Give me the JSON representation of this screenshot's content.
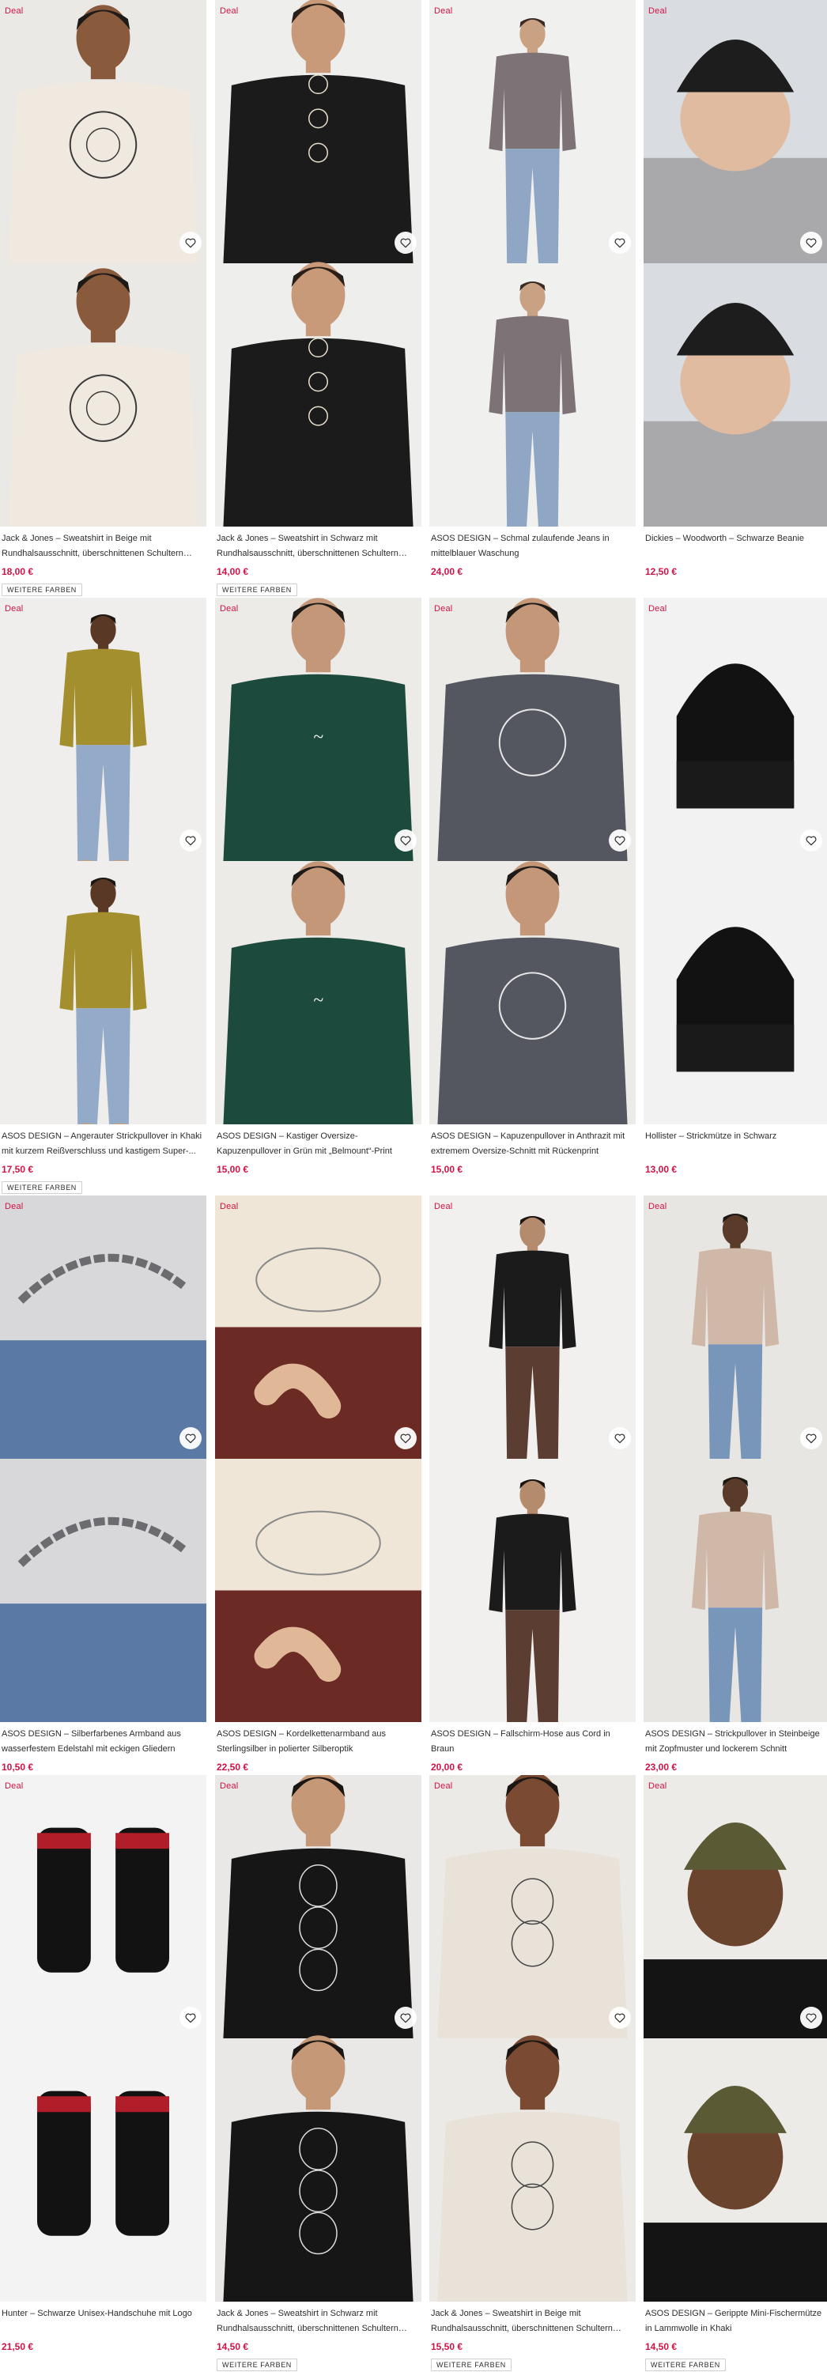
{
  "deal_label": "Deal",
  "more_colors_label": "WEITERE FARBEN",
  "colors": {
    "accent": "#d01345",
    "text": "#2d2d2d"
  },
  "products": [
    {
      "title": "Jack & Jones – Sweatshirt in Beige mit Rundhalsausschnitt, überschnittenen Schultern und...",
      "price": "18,00 €",
      "deal": true,
      "more_colors": true,
      "kind": "sweat-beige"
    },
    {
      "title": "Jack & Jones – Sweatshirt in Schwarz mit Rundhalsausschnitt, überschnittenen Schultern und...",
      "price": "14,00 €",
      "deal": true,
      "more_colors": true,
      "kind": "sweat-black"
    },
    {
      "title": "ASOS DESIGN – Schmal zulaufende Jeans in mittelblauer Waschung",
      "price": "24,00 €",
      "deal": true,
      "more_colors": false,
      "kind": "jeans"
    },
    {
      "title": "Dickies – Woodworth – Schwarze Beanie",
      "price": "12,50 €",
      "deal": true,
      "more_colors": false,
      "kind": "beanie-black"
    },
    {
      "title": "ASOS DESIGN – Angerauter Strickpullover in Khaki mit kurzem Reißverschluss und kastigem Super-...",
      "price": "17,50 €",
      "deal": true,
      "more_colors": true,
      "kind": "knit-khaki"
    },
    {
      "title": "ASOS DESIGN – Kastiger Oversize-Kapuzenpullover in Grün mit „Belmount“-Print",
      "price": "15,00 €",
      "deal": true,
      "more_colors": false,
      "kind": "hoodie-green"
    },
    {
      "title": "ASOS DESIGN – Kapuzenpullover in Anthrazit mit extremem Oversize-Schnitt mit Rückenprint",
      "price": "15,00 €",
      "deal": true,
      "more_colors": false,
      "kind": "hoodie-grey"
    },
    {
      "title": "Hollister – Strickmütze in Schwarz",
      "price": "13,00 €",
      "deal": true,
      "more_colors": false,
      "kind": "beanie-hollister"
    },
    {
      "title": "ASOS DESIGN – Silberfarbenes Armband aus wasserfestem Edelstahl mit eckigen Gliedern",
      "price": "10,50 €",
      "deal": true,
      "more_colors": false,
      "kind": "bracelet-chain"
    },
    {
      "title": "ASOS DESIGN – Kordelkettenarmband aus Sterlingsilber in polierter Silberoptik",
      "price": "22,50 €",
      "deal": true,
      "more_colors": false,
      "kind": "bracelet-cord"
    },
    {
      "title": "ASOS DESIGN – Fallschirm-Hose aus Cord in Braun",
      "price": "20,00 €",
      "deal": true,
      "more_colors": false,
      "kind": "cord-pants"
    },
    {
      "title": "ASOS DESIGN – Strickpullover in Steinbeige mit Zopfmuster und lockerem Schnitt",
      "price": "23,00 €",
      "deal": true,
      "more_colors": false,
      "kind": "knit-stone"
    },
    {
      "title": "Hunter – Schwarze Unisex-Handschuhe mit Logo",
      "price": "21,50 €",
      "deal": true,
      "more_colors": false,
      "kind": "gloves"
    },
    {
      "title": "Jack & Jones – Sweatshirt in Schwarz mit Rundhalsausschnitt, überschnittenen Schultern und...",
      "price": "14,50 €",
      "deal": true,
      "more_colors": true,
      "kind": "skull-black"
    },
    {
      "title": "Jack & Jones – Sweatshirt in Beige mit Rundhalsausschnitt, überschnittenen Schultern und...",
      "price": "15,50 €",
      "deal": true,
      "more_colors": true,
      "kind": "skull-beige"
    },
    {
      "title": "ASOS DESIGN – Gerippte Mini-Fischermütze in Lammwolle in Khaki",
      "price": "14,50 €",
      "deal": true,
      "more_colors": true,
      "kind": "beanie-khaki"
    }
  ]
}
